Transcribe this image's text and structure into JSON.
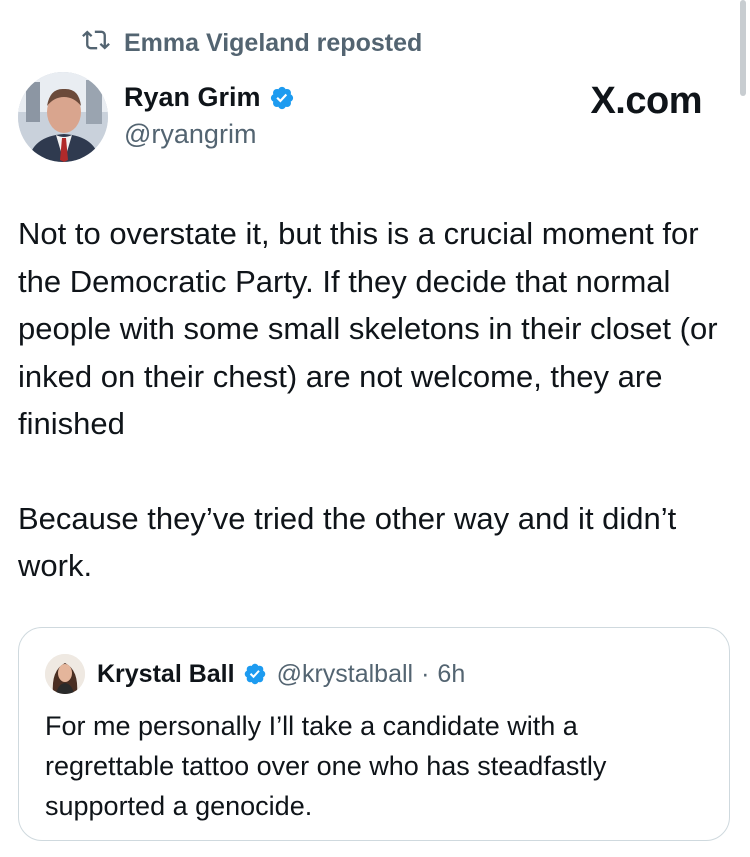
{
  "repost": {
    "icon": "repost-icon",
    "label": "Emma Vigeland reposted"
  },
  "author": {
    "name": "Ryan Grim",
    "handle": "@ryangrim",
    "verified": true
  },
  "brand": "X.com",
  "tweet": {
    "paragraphs": [
      "Not to overstate it, but this is a crucial moment for the Democratic Party. If they decide that normal people with some small skeletons in their closet (or inked on their chest) are not welcome, they are finished",
      "Because they’ve tried the other way and it didn’t work."
    ]
  },
  "quote": {
    "name": "Krystal Ball",
    "handle": "@krystalball",
    "separator": "·",
    "time": "6h",
    "text": "For me personally I’ll take a candidate with a regrettable tattoo over one who has steadfastly supported a genocide."
  },
  "colors": {
    "text": "#0f1419",
    "muted": "#536471",
    "verified": "#1d9bf0",
    "border": "#cfd9de"
  }
}
